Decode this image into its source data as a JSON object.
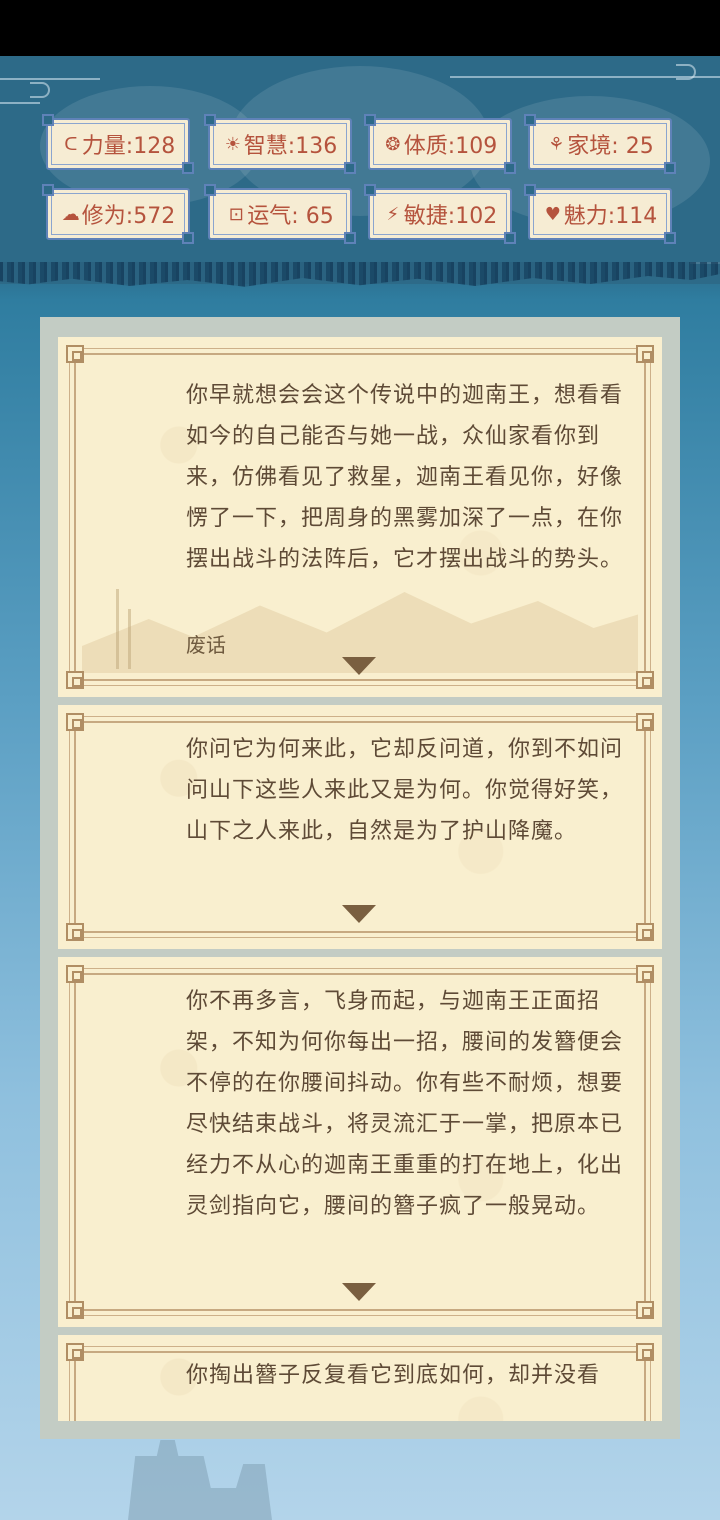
{
  "stats": [
    {
      "icon": "arm-icon",
      "glyph": "ᑕ",
      "text": "力量:128"
    },
    {
      "icon": "bulb-icon",
      "glyph": "☀",
      "text": "智慧:136"
    },
    {
      "icon": "cycle-icon",
      "glyph": "❂",
      "text": "体质:109"
    },
    {
      "icon": "family-icon",
      "glyph": "⚘",
      "text": "家境: 25"
    },
    {
      "icon": "cloud-icon",
      "glyph": "☁",
      "text": "修为:572"
    },
    {
      "icon": "dice-icon",
      "glyph": "⊡",
      "text": "运气: 65"
    },
    {
      "icon": "lightning-icon",
      "glyph": "⚡",
      "text": "敏捷:102"
    },
    {
      "icon": "heart-icon",
      "glyph": "♥",
      "text": "魅力:114"
    }
  ],
  "story": {
    "cards": [
      {
        "text": "你早就想会会这个传说中的迦南王，想看看如今的自己能否与她一战，众仙家看你到来，仿佛看见了救星，迦南王看见你，好像愣了一下，把周身的黑雾加深了一点，在你摆出战斗的法阵后，它才摆出战斗的势头。",
        "choice": "废话"
      },
      {
        "text": "你问它为何来此，它却反问道，你到不如问问山下这些人来此又是为何。你觉得好笑，山下之人来此，自然是为了护山降魔。"
      },
      {
        "text": "你不再多言，飞身而起，与迦南王正面招架，不知为何你每出一招，腰间的发簪便会不停的在你腰间抖动。你有些不耐烦，想要尽快结束战斗，将灵流汇于一掌，把原本已经力不从心的迦南王重重的打在地上，化出灵剑指向它，腰间的簪子疯了一般晃动。"
      },
      {
        "text": "你掏出簪子反复看它到底如何，却并没看"
      }
    ]
  }
}
